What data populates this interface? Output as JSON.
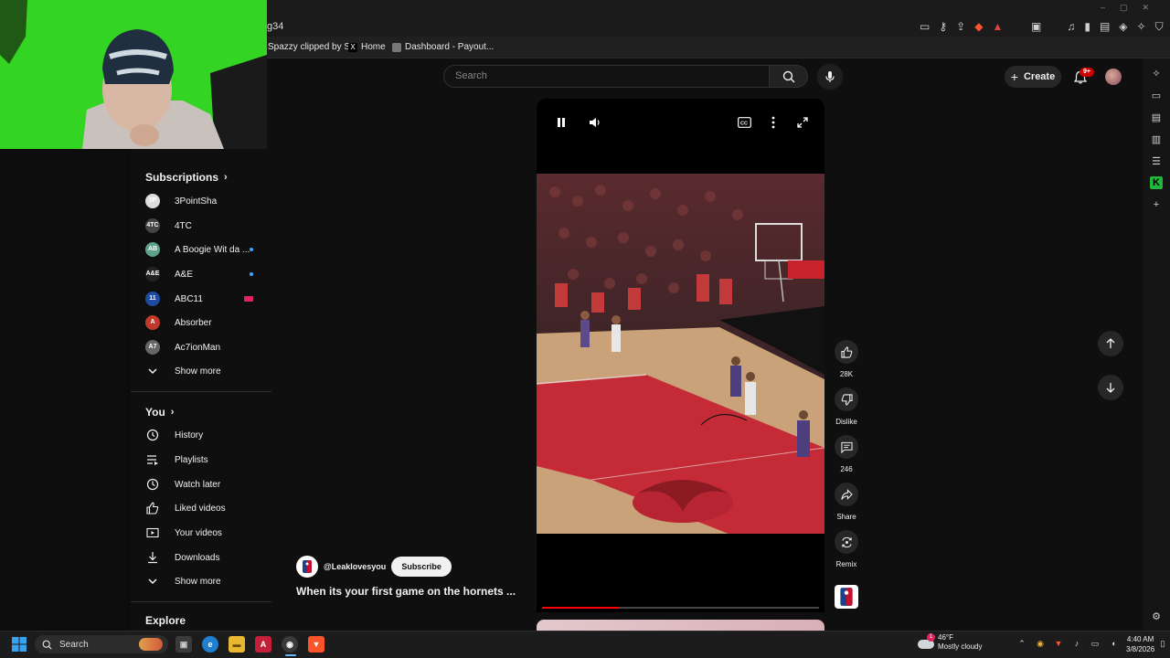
{
  "browser": {
    "url_fragment": "g34",
    "bookmarks": [
      "Spazzy clipped by S...",
      "Home",
      "Dashboard - Payout..."
    ]
  },
  "header": {
    "search_placeholder": "Search",
    "create_label": "Create",
    "notification_count": "9+"
  },
  "sidebar": {
    "subscriptions_title": "Subscriptions",
    "subscriptions": [
      {
        "name": "3PointSha",
        "indicator": "none",
        "color": "#ddd"
      },
      {
        "name": "4TC",
        "indicator": "none",
        "color": "#444"
      },
      {
        "name": "A Boogie Wit da ...",
        "indicator": "new",
        "color": "#5fa08c"
      },
      {
        "name": "A&E",
        "indicator": "new",
        "color": "#222"
      },
      {
        "name": "ABC11",
        "indicator": "live",
        "color": "#1e4aa0"
      },
      {
        "name": "Absorber",
        "indicator": "none",
        "color": "#c03a2b"
      },
      {
        "name": "Ac7ionMan",
        "indicator": "none",
        "color": "#666"
      }
    ],
    "subs_show_more": "Show more",
    "you_title": "You",
    "you_items": [
      "History",
      "Playlists",
      "Watch later",
      "Liked videos",
      "Your videos",
      "Downloads",
      "Show more"
    ],
    "explore_title": "Explore"
  },
  "short": {
    "channel": "@Leaklovesyou",
    "subscribe_label": "Subscribe",
    "title": "When its your first game on the hornets ...",
    "progress": 0.28,
    "actions": {
      "likes": "28K",
      "dislike_label": "Dislike",
      "comments": "246",
      "share_label": "Share",
      "remix_label": "Remix"
    }
  },
  "taskbar": {
    "search_label": "Search",
    "weather_temp": "46°F",
    "weather_desc": "Mostly cloudy",
    "weather_alert": "1",
    "time": "4:40 AM",
    "date": "3/8/2026"
  }
}
